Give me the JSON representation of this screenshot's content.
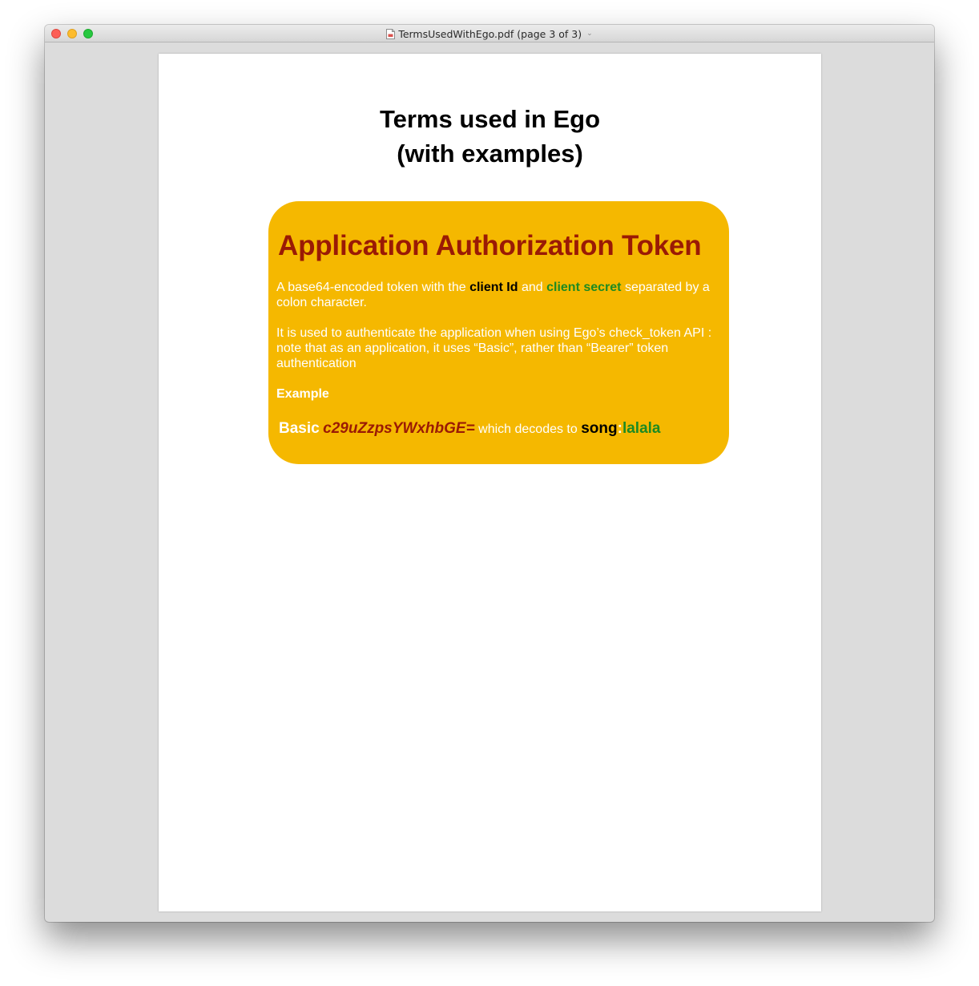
{
  "window": {
    "title": "TermsUsedWithEgo.pdf (page 3 of 3)",
    "title_icon": "pdf-document-icon",
    "dropdown_icon": "chevron-down-icon",
    "buttons": [
      "close",
      "minimize",
      "zoom"
    ]
  },
  "document": {
    "title_line1": "Terms used in Ego",
    "title_line2": "(with examples)",
    "card": {
      "heading": "Application Authorization Token",
      "para1": {
        "pre": "A base64-encoded token with the ",
        "client_id": "client Id",
        "and": " and ",
        "client_secret": "client secret",
        "post": " separated by a colon character."
      },
      "para2": "It is used to authenticate the application when using Ego’s check_token API : note that as an application, it uses “Basic”, rather than “Bearer” token authentication",
      "example_label": "Example",
      "example": {
        "basic": "Basic",
        "encoded": "c29uZzpsYWxhbGE=",
        "decodes_text": "which decodes to",
        "client_id_value": "song",
        "separator": ":",
        "client_secret_value": "lalala"
      }
    }
  },
  "colors": {
    "card_background": "#f5b800",
    "heading": "#9a1a05",
    "client_secret": "#1d8a22",
    "body_text": "#ffffff"
  }
}
